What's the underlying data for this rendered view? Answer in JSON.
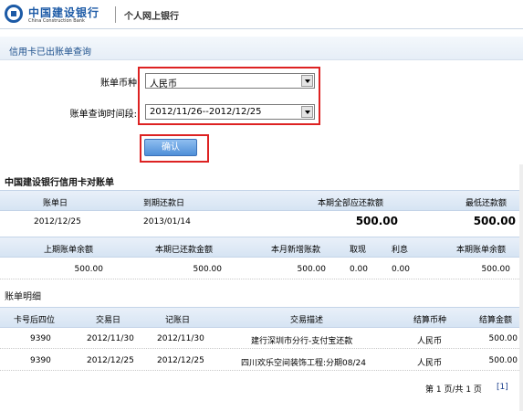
{
  "header": {
    "brand_cn": "中国建设银行",
    "brand_en": "China Construction Bank",
    "subtitle": "个人网上银行"
  },
  "section_title": "信用卡已出账单查询",
  "form": {
    "currency_label": "账单币种",
    "currency_value": "人民币",
    "period_label": "账单查询时间段:",
    "period_value": "2012/11/26--2012/12/25",
    "confirm_label": "确认"
  },
  "statement": {
    "title": "中国建设银行信用卡对账单",
    "header1": [
      "账单日",
      "到期还款日",
      "本期全部应还款额",
      "最低还款额"
    ],
    "row1": [
      "2012/12/25",
      "2013/01/14",
      "500.00",
      "500.00"
    ],
    "header2": [
      "上期账单余额",
      "本期已还款金额",
      "本月新增账款",
      "取现",
      "利息",
      "本期账单余额"
    ],
    "row2": [
      "500.00",
      "500.00",
      "500.00",
      "0.00",
      "0.00",
      "500.00"
    ]
  },
  "details": {
    "title": "账单明细",
    "columns": [
      "卡号后四位",
      "交易日",
      "记账日",
      "交易描述",
      "结算币种",
      "结算金额"
    ],
    "rows": [
      [
        "9390",
        "2012/11/30",
        "2012/11/30",
        "建行深圳市分行-支付宝还款",
        "人民币",
        "500.00"
      ],
      [
        "9390",
        "2012/12/25",
        "2012/12/25",
        "四川欢乐空间装饰工程:分期08/24",
        "人民币",
        "500.00"
      ]
    ]
  },
  "pager": {
    "text": "第 1 页/共 1 页",
    "link": "[1]"
  },
  "colors": {
    "brand": "#1c5aa6",
    "highlight": "#dd2222",
    "button": "#4f8fd8"
  }
}
